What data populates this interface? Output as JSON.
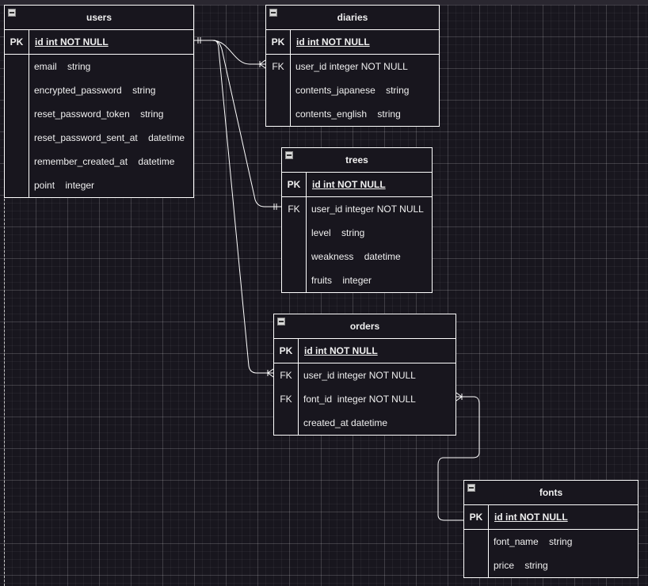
{
  "diagram": {
    "type": "er-diagram",
    "tables": [
      {
        "name": "users",
        "pk": {
          "key": "PK",
          "field": "id int NOT NULL"
        },
        "fields": [
          {
            "key": "",
            "field": "email    string"
          },
          {
            "key": "",
            "field": "encrypted_password    string"
          },
          {
            "key": "",
            "field": "reset_password_token    string"
          },
          {
            "key": "",
            "field": "reset_password_sent_at    datetime"
          },
          {
            "key": "",
            "field": "remember_created_at    datetime"
          },
          {
            "key": "",
            "field": "point    integer"
          }
        ]
      },
      {
        "name": "diaries",
        "pk": {
          "key": "PK",
          "field": "id int NOT NULL"
        },
        "fields": [
          {
            "key": "FK",
            "field": "user_id integer NOT NULL"
          },
          {
            "key": "",
            "field": "contents_japanese    string"
          },
          {
            "key": "",
            "field": "contents_english    string"
          }
        ]
      },
      {
        "name": "trees",
        "pk": {
          "key": "PK",
          "field": "id int NOT NULL"
        },
        "fields": [
          {
            "key": "FK",
            "field": "user_id integer NOT NULL"
          },
          {
            "key": "",
            "field": "level    string"
          },
          {
            "key": "",
            "field": "weakness    datetime"
          },
          {
            "key": "",
            "field": "fruits    integer"
          }
        ]
      },
      {
        "name": "orders",
        "pk": {
          "key": "PK",
          "field": "id int NOT NULL"
        },
        "fields": [
          {
            "key": "FK",
            "field": "user_id integer NOT NULL"
          },
          {
            "key": "FK",
            "field": "font_id  integer NOT NULL"
          },
          {
            "key": "",
            "field": "created_at datetime"
          }
        ]
      },
      {
        "name": "fonts",
        "pk": {
          "key": "PK",
          "field": "id int NOT NULL"
        },
        "fields": [
          {
            "key": "",
            "field": "font_name    string"
          },
          {
            "key": "",
            "field": "price    string"
          }
        ]
      }
    ],
    "relations": [
      {
        "from": "users.id",
        "to": "diaries.user_id",
        "from_cardinality": "one-and-only-one",
        "to_cardinality": "one-or-many"
      },
      {
        "from": "users.id",
        "to": "trees.user_id",
        "from_cardinality": "one-and-only-one",
        "to_cardinality": "one-and-only-one"
      },
      {
        "from": "users.id",
        "to": "orders.user_id",
        "from_cardinality": "one-and-only-one",
        "to_cardinality": "one-or-many"
      },
      {
        "from": "fonts.id",
        "to": "orders.font_id",
        "from_cardinality": "none",
        "to_cardinality": "one-or-many"
      }
    ]
  },
  "colors": {
    "background": "#18161e",
    "line": "#ffffff",
    "text": "#f0f0f0"
  }
}
